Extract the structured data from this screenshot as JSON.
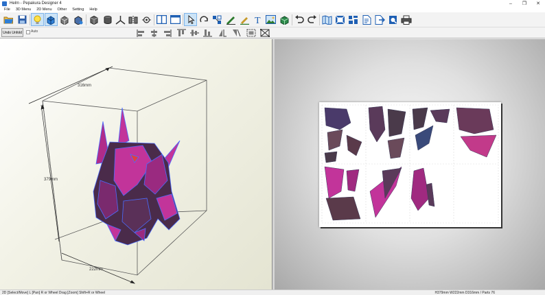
{
  "window": {
    "title": "Helm - Pepakura Designer 4",
    "controls": {
      "minimize": "–",
      "maximize": "❐",
      "close": "✕"
    }
  },
  "menu": [
    "File",
    "3D Menu",
    "2D Menu",
    "Other",
    "Setting",
    "Help"
  ],
  "toolbar": {
    "buttons": [
      "open-icon",
      "save-icon",
      "light-icon",
      "texture-icon",
      "rotate-model-icon",
      "cube-icon",
      "cylinder-icon",
      "join-edge-icon",
      "split-icon",
      "edge-icon",
      "layout-split-icon",
      "layout-single-icon",
      "select-move-icon",
      "rotate-part-icon",
      "arrange-icon",
      "line-style-icon",
      "flap-icon",
      "text-icon",
      "image-icon",
      "model-icon",
      "undo-icon",
      "redo-icon",
      "map-icon",
      "zoom-fit-icon",
      "grid-icon",
      "page-icon",
      "export-icon",
      "print-preview-icon",
      "print-icon"
    ],
    "active": [
      "light-icon",
      "rotate-model-icon",
      "select-move-icon"
    ]
  },
  "toolbar2": {
    "unfold_label": "Undo Unfold",
    "auto_label": "Auto",
    "buttons": [
      "align-left-icon",
      "align-center-icon",
      "align-right-icon",
      "align-top-icon",
      "align-middle-icon",
      "align-bottom-icon",
      "flip-h-icon",
      "flip-v-icon",
      "group-icon",
      "ungroup-icon"
    ]
  },
  "view3d": {
    "dims": {
      "width": "316mm",
      "height": "379mm",
      "depth": "222mm"
    }
  },
  "status": {
    "left": "2D [Select/Move] L [Pan] R or Wheel Drag [Zoom] Shift+R or Wheel",
    "right": "H379mm W222mm D316mm / Parts 76"
  },
  "colors": {
    "accent": "#cce4f7",
    "model_magenta": "#c2349a",
    "model_dark": "#4a2b4a",
    "model_blue": "#3f5fd6"
  }
}
